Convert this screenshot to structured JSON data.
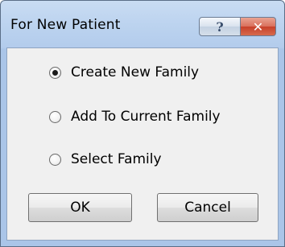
{
  "window": {
    "title": "For New Patient",
    "help_glyph": "?",
    "close_glyph": "✕"
  },
  "options": [
    {
      "label": "Create New Family",
      "checked": true
    },
    {
      "label": "Add To Current Family",
      "checked": false
    },
    {
      "label": "Select Family",
      "checked": false
    }
  ],
  "buttons": {
    "ok_label": "OK",
    "cancel_label": "Cancel"
  }
}
